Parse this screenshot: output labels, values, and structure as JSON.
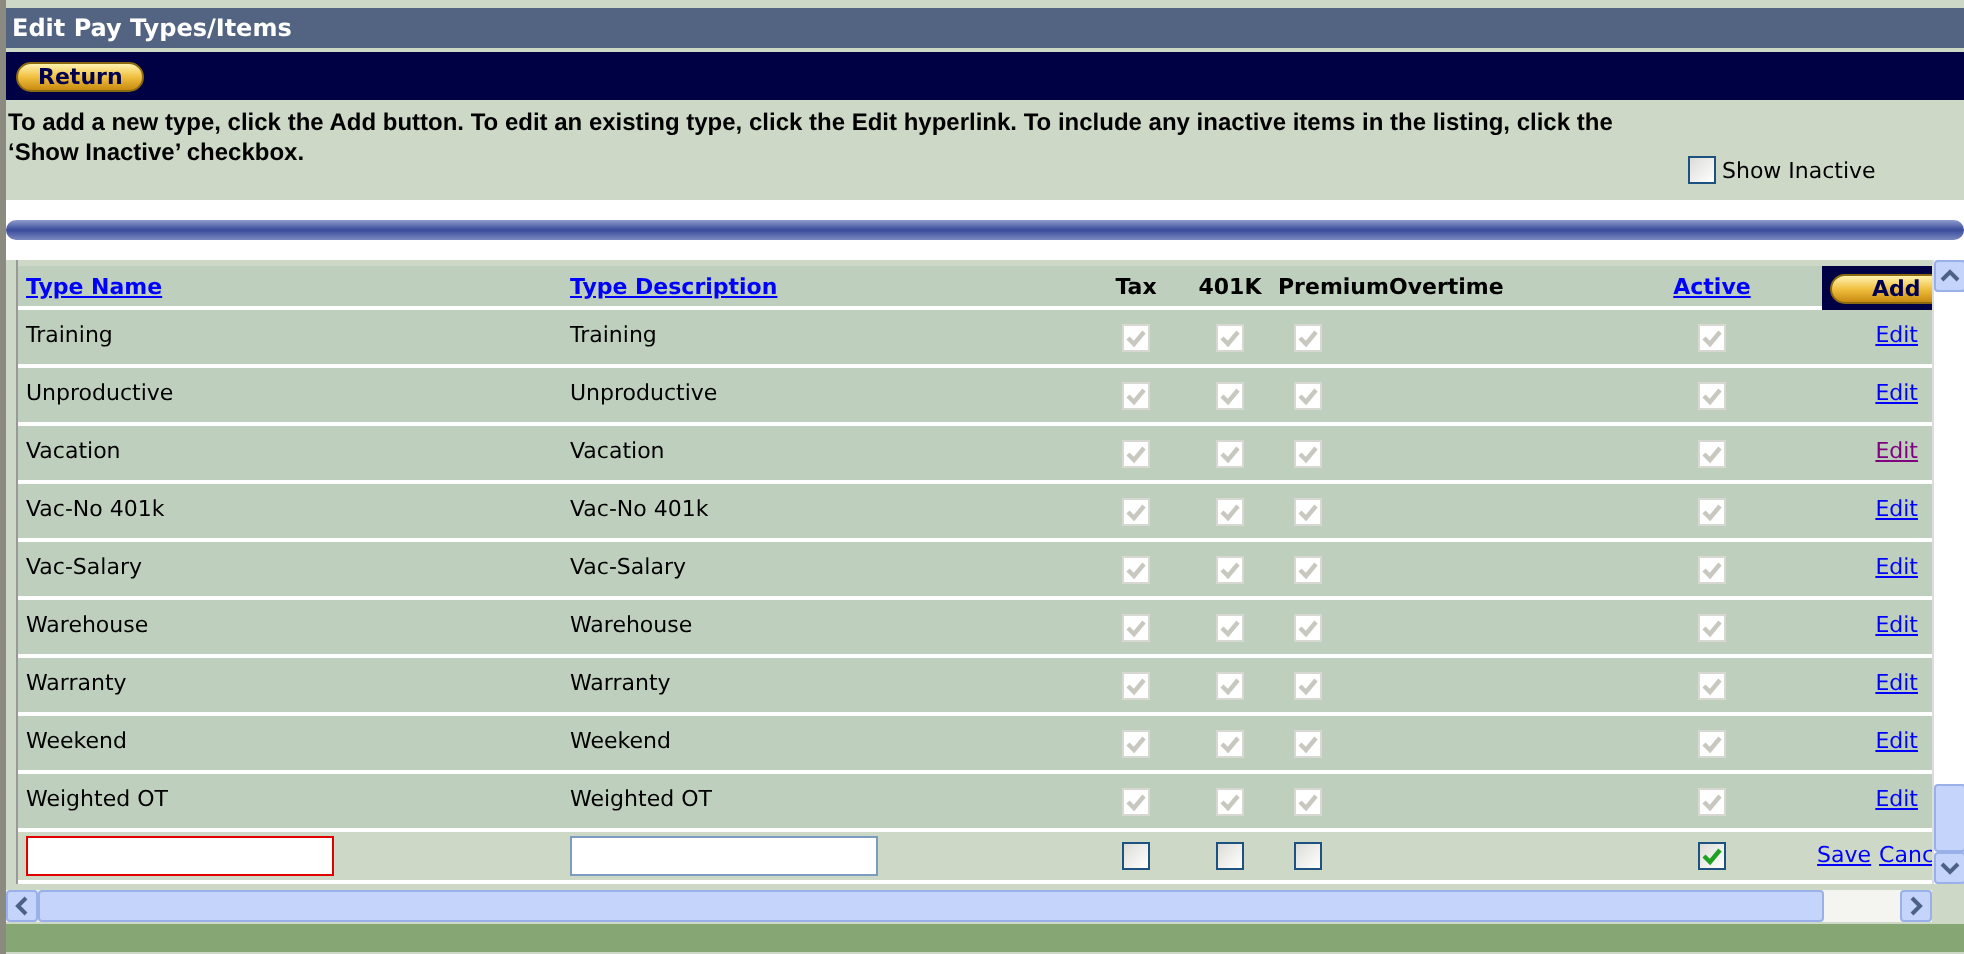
{
  "title": "Edit Pay Types/Items",
  "return_button": "Return",
  "instructions": "To add a new type, click the Add button. To edit an existing type, click the Edit hyperlink. To include any inactive items in the listing, click the ‘Show Inactive’ checkbox.",
  "show_inactive": {
    "label": "Show Inactive",
    "checked": false
  },
  "columns": [
    {
      "label": "Type Name",
      "kind": "link"
    },
    {
      "label": "Type Description",
      "kind": "link"
    },
    {
      "label": "Tax",
      "kind": "plain"
    },
    {
      "label": "401K",
      "kind": "plain"
    },
    {
      "label": "Premium",
      "kind": "plain"
    },
    {
      "label": "Overtime",
      "kind": "plain"
    },
    {
      "label": "Active",
      "kind": "link"
    }
  ],
  "add_button": "Add",
  "rows": [
    {
      "name": "Training",
      "description": "Training",
      "tax": true,
      "k401": true,
      "premium": true,
      "active": true,
      "action": "Edit",
      "visited": false
    },
    {
      "name": "Unproductive",
      "description": "Unproductive",
      "tax": true,
      "k401": true,
      "premium": true,
      "active": true,
      "action": "Edit",
      "visited": false
    },
    {
      "name": "Vacation",
      "description": "Vacation",
      "tax": true,
      "k401": true,
      "premium": true,
      "active": true,
      "action": "Edit",
      "visited": true
    },
    {
      "name": "Vac-No 401k",
      "description": "Vac-No 401k",
      "tax": true,
      "k401": true,
      "premium": true,
      "active": true,
      "action": "Edit",
      "visited": false
    },
    {
      "name": "Vac-Salary",
      "description": "Vac-Salary",
      "tax": true,
      "k401": true,
      "premium": true,
      "active": true,
      "action": "Edit",
      "visited": false
    },
    {
      "name": "Warehouse",
      "description": "Warehouse",
      "tax": true,
      "k401": true,
      "premium": true,
      "active": true,
      "action": "Edit",
      "visited": false
    },
    {
      "name": "Warranty",
      "description": "Warranty",
      "tax": true,
      "k401": true,
      "premium": true,
      "active": true,
      "action": "Edit",
      "visited": false
    },
    {
      "name": "Weekend",
      "description": "Weekend",
      "tax": true,
      "k401": true,
      "premium": true,
      "active": true,
      "action": "Edit",
      "visited": false
    },
    {
      "name": "Weighted OT",
      "description": "Weighted OT",
      "tax": true,
      "k401": true,
      "premium": true,
      "active": true,
      "action": "Edit",
      "visited": false
    }
  ],
  "new_row": {
    "name_invalid": true,
    "tax": false,
    "k401": false,
    "premium": false,
    "active": true,
    "save": "Save",
    "cancel": "Canc"
  }
}
